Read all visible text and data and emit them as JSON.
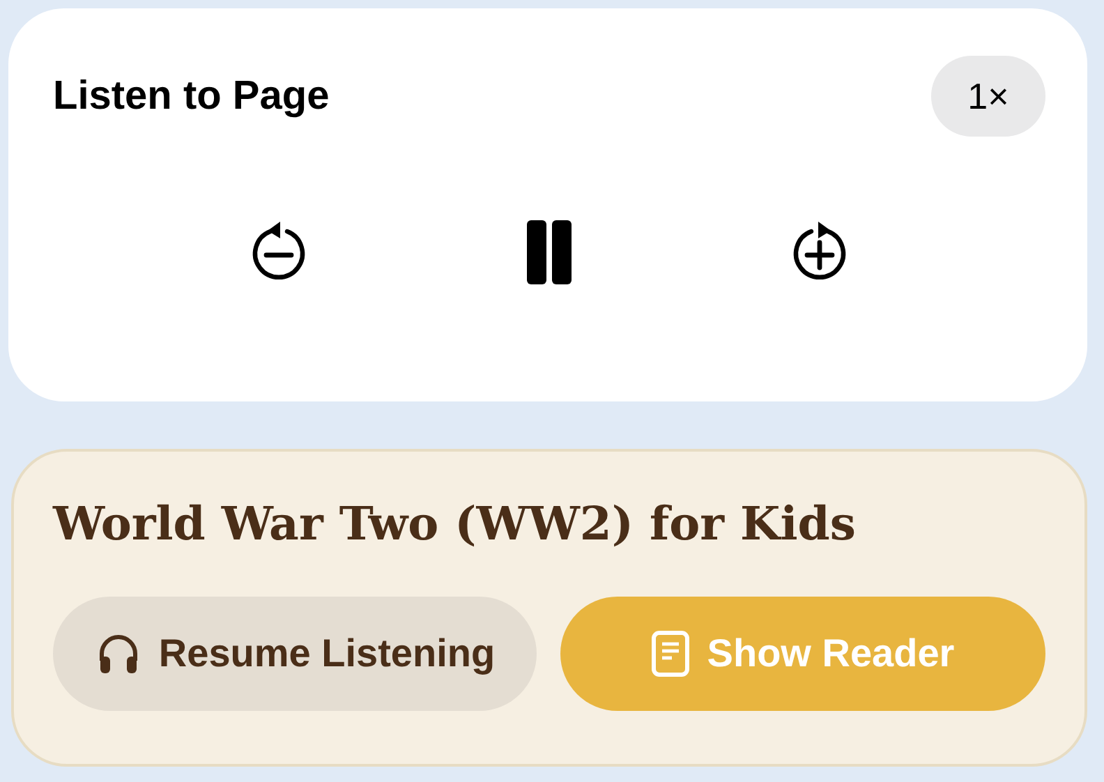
{
  "player": {
    "title": "Listen to Page",
    "speed": "1×",
    "playing": true
  },
  "article": {
    "title": "World War Two (WW2) for Kids",
    "buttons": [
      {
        "kind": "listen",
        "label": "Resume Listening"
      },
      {
        "kind": "reader",
        "label": "Show Reader"
      }
    ]
  }
}
